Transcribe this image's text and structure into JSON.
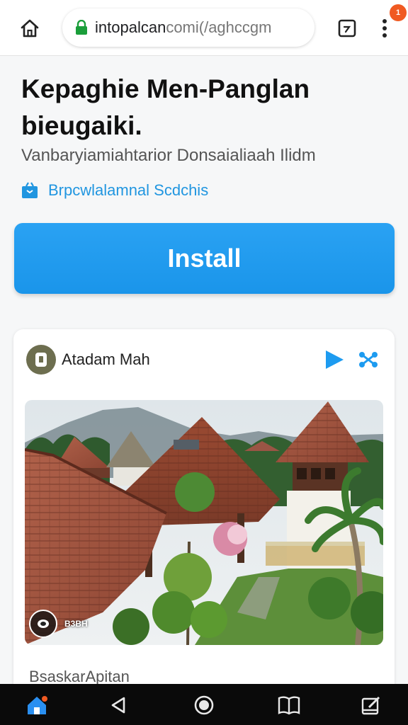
{
  "browser": {
    "url_host": "intopalcan",
    "url_path": "comi(/aghccgm",
    "notification_count": "1"
  },
  "page": {
    "title": "Kepaghie Men-Panglan bieugaiki.",
    "subtitle": "Vanbaryiamiahtarior Donsaialiaah Ilidm",
    "category": "Brpcwlalamnal Scdchis",
    "install_label": "Install"
  },
  "card": {
    "username": "Atadam Mah",
    "overlay_label": "B3BH",
    "caption": "BsaskarApitan"
  },
  "icons": {
    "home": "home-icon",
    "lock": "lock-icon",
    "tabs": "tab-switcher-icon",
    "menu": "more-vert-icon",
    "category": "shopping-bag-icon",
    "avatar": "lock-badge-icon",
    "play": "play-icon",
    "share": "share-icon",
    "nav_home": "home-icon",
    "nav_back": "back-icon",
    "nav_home_circle": "home-circle-icon",
    "nav_books": "book-icon",
    "nav_edit": "edit-icon"
  },
  "colors": {
    "accent": "#1d9bf0",
    "lock_green": "#1a9e3a",
    "badge": "#f05a22",
    "avatar_bg": "#6d6e4f"
  }
}
